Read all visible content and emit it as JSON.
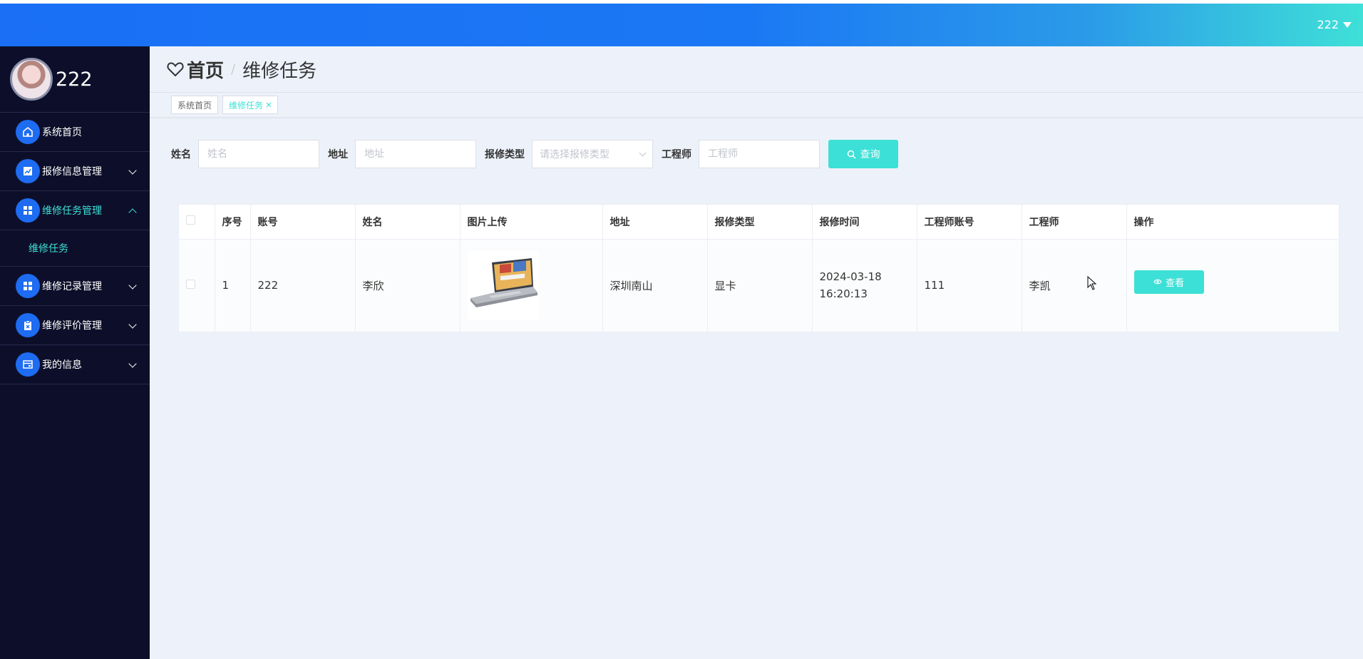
{
  "header": {
    "user": "222"
  },
  "sidebar": {
    "profile_name": "222",
    "items": [
      {
        "label": "系统首页"
      },
      {
        "label": "报修信息管理"
      },
      {
        "label": "维修任务管理"
      },
      {
        "label": "维修记录管理"
      },
      {
        "label": "维修评价管理"
      },
      {
        "label": "我的信息"
      }
    ],
    "submenu": {
      "label": "维修任务"
    }
  },
  "breadcrumb": {
    "home": "首页",
    "separator": "/",
    "current": "维修任务"
  },
  "tags": [
    {
      "label": "系统首页"
    },
    {
      "label": "维修任务"
    }
  ],
  "filters": {
    "name_label": "姓名",
    "name_placeholder": "姓名",
    "address_label": "地址",
    "address_placeholder": "地址",
    "type_label": "报修类型",
    "type_placeholder": "请选择报修类型",
    "engineer_label": "工程师",
    "engineer_placeholder": "工程师",
    "search_label": "查询"
  },
  "table": {
    "headers": [
      "序号",
      "账号",
      "姓名",
      "图片上传",
      "地址",
      "报修类型",
      "报修时间",
      "工程师账号",
      "工程师",
      "操作"
    ],
    "rows": [
      {
        "index": "1",
        "account": "222",
        "name": "李欣",
        "address": "深圳南山",
        "type": "显卡",
        "time": "2024-03-18 16:20:13",
        "engineer_account": "111",
        "engineer": "李凯",
        "action": "查看"
      }
    ]
  },
  "colors": {
    "accent": "#3de0d6",
    "primary": "#1d6cf2",
    "sidebar_bg": "#0d0f2a"
  }
}
